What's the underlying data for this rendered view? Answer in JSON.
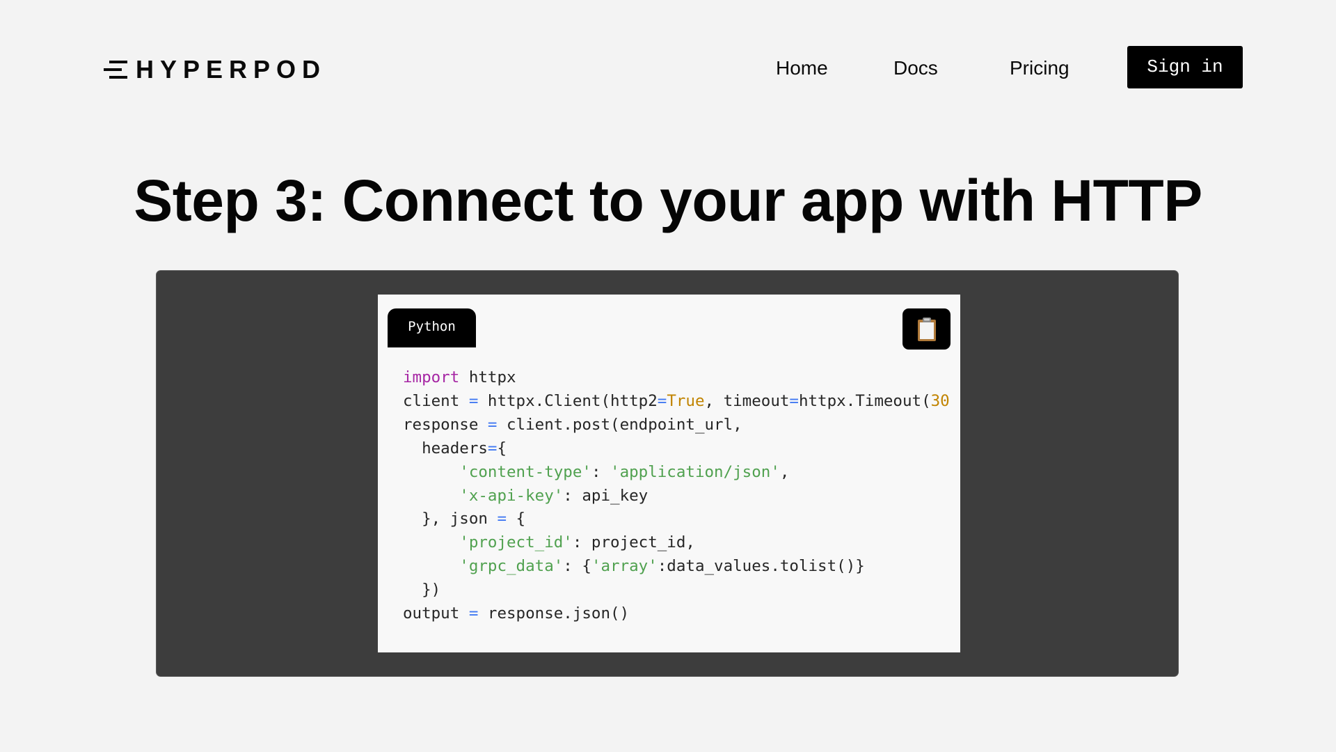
{
  "brand": {
    "name": "HYPERPOD",
    "logo_icon": "speed-lines-icon"
  },
  "nav": {
    "home": "Home",
    "docs": "Docs",
    "pricing": "Pricing",
    "sign_in": "Sign in"
  },
  "hero": {
    "title": "Step 3: Connect to your app with HTTP"
  },
  "code_block": {
    "language_tab": "Python",
    "copy_icon": "clipboard-icon",
    "colors": {
      "keyword": "#a626a4",
      "operator": "#4078f2",
      "string": "#50a14f",
      "literal": "#c18401",
      "panel_background": "#3d3d3d",
      "card_background": "#f8f8f8"
    },
    "lines": [
      [
        {
          "t": "kw",
          "v": "import"
        },
        {
          "t": "plain",
          "v": " httpx"
        }
      ],
      [
        {
          "t": "plain",
          "v": "client "
        },
        {
          "t": "op",
          "v": "="
        },
        {
          "t": "plain",
          "v": " httpx.Client(http2"
        },
        {
          "t": "op",
          "v": "="
        },
        {
          "t": "num",
          "v": "True"
        },
        {
          "t": "plain",
          "v": ", timeout"
        },
        {
          "t": "op",
          "v": "="
        },
        {
          "t": "plain",
          "v": "httpx.Timeout("
        },
        {
          "t": "num",
          "v": "30"
        }
      ],
      [
        {
          "t": "plain",
          "v": "response "
        },
        {
          "t": "op",
          "v": "="
        },
        {
          "t": "plain",
          "v": " client.post(endpoint_url,"
        }
      ],
      [
        {
          "t": "plain",
          "v": "  headers"
        },
        {
          "t": "op",
          "v": "="
        },
        {
          "t": "plain",
          "v": "{"
        }
      ],
      [
        {
          "t": "plain",
          "v": "      "
        },
        {
          "t": "str",
          "v": "'content-type'"
        },
        {
          "t": "plain",
          "v": ": "
        },
        {
          "t": "str",
          "v": "'application/json'"
        },
        {
          "t": "plain",
          "v": ","
        }
      ],
      [
        {
          "t": "plain",
          "v": "      "
        },
        {
          "t": "str",
          "v": "'x-api-key'"
        },
        {
          "t": "plain",
          "v": ": api_key"
        }
      ],
      [
        {
          "t": "plain",
          "v": "  }, json "
        },
        {
          "t": "op",
          "v": "="
        },
        {
          "t": "plain",
          "v": " {"
        }
      ],
      [
        {
          "t": "plain",
          "v": "      "
        },
        {
          "t": "str",
          "v": "'project_id'"
        },
        {
          "t": "plain",
          "v": ": project_id,"
        }
      ],
      [
        {
          "t": "plain",
          "v": "      "
        },
        {
          "t": "str",
          "v": "'grpc_data'"
        },
        {
          "t": "plain",
          "v": ": {"
        },
        {
          "t": "str",
          "v": "'array'"
        },
        {
          "t": "plain",
          "v": ":data_values.tolist()}"
        }
      ],
      [
        {
          "t": "plain",
          "v": "  })"
        }
      ],
      [
        {
          "t": "plain",
          "v": "output "
        },
        {
          "t": "op",
          "v": "="
        },
        {
          "t": "plain",
          "v": " response.json()"
        }
      ]
    ]
  }
}
